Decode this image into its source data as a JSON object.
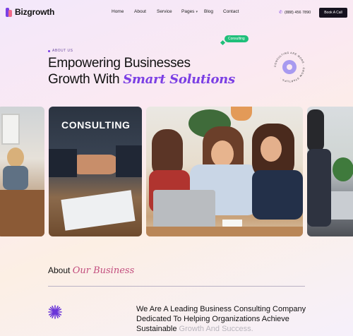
{
  "brand": {
    "name": "Bizgrowth"
  },
  "nav": {
    "items": [
      {
        "label": "Home"
      },
      {
        "label": "About"
      },
      {
        "label": "Service"
      },
      {
        "label": "Pages"
      },
      {
        "label": "Blog"
      },
      {
        "label": "Contact"
      }
    ]
  },
  "header": {
    "phone": "(888) 456 7890",
    "cta_label": "Book A Call"
  },
  "hero": {
    "eyebrow": "ABOUT US",
    "headline_line1": "Empowering Businesses",
    "headline_line2_plain": "Growth With ",
    "headline_line2_accent": "Smart Solutions",
    "tag": "Consulting",
    "badge_ring_text": "CONSULTING ARE MORE · GROW STARTUPS ·"
  },
  "gallery": {
    "overlay_text": "CONSULTING"
  },
  "about": {
    "title_plain": "About ",
    "title_accent": "Our Business",
    "lead_dark": "We Are A Leading Business Consulting Company Dedicated To Helping Organizations Achieve Sustainable ",
    "lead_muted": "Growth And Success."
  },
  "colors": {
    "accent_purple": "#7b3fe4",
    "accent_pink": "#c24d7e",
    "tag_green": "#1fbf7a",
    "button_dark": "#16121f"
  },
  "icons": {
    "phone": "phone-icon",
    "pages_caret": "chevron-down-icon",
    "badge": "play-badge-icon",
    "about": "sparkle-star-icon"
  }
}
